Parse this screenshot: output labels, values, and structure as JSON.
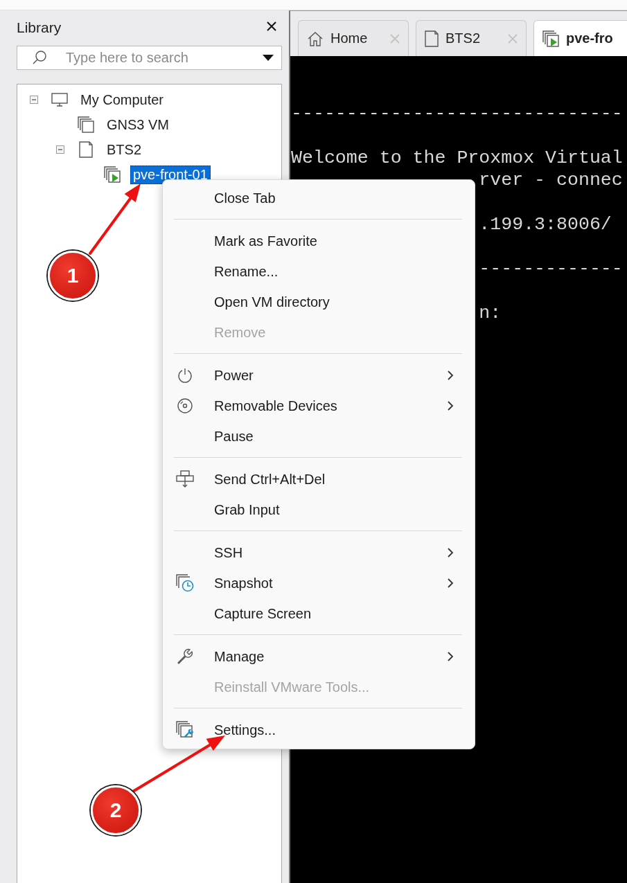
{
  "library": {
    "title": "Library"
  },
  "search": {
    "placeholder": "Type here to search"
  },
  "tree": [
    {
      "label": "My Computer",
      "kind": "computer",
      "expanded": true,
      "selected": false,
      "children": [
        {
          "label": "GNS3 VM",
          "kind": "vm",
          "running": false,
          "selected": false
        },
        {
          "label": "BTS2",
          "kind": "folder",
          "expanded": true,
          "selected": false,
          "children": [
            {
              "label": "pve-front-01",
              "kind": "vm",
              "running": true,
              "selected": true
            }
          ]
        }
      ]
    }
  ],
  "tabs": [
    {
      "label": "Home",
      "kind": "home",
      "selected": false
    },
    {
      "label": "BTS2",
      "kind": "folder",
      "selected": false
    },
    {
      "label": "pve-fro",
      "kind": "vm",
      "selected": true
    }
  ],
  "terminal": {
    "lines": [
      {
        "text": "------------------------------",
        "blank_before": false,
        "covered": false
      },
      {
        "text": "Welcome to the Proxmox Virtual",
        "blank_before": true,
        "covered": false
      },
      {
        "text": "rver - connec",
        "blank_before": false,
        "covered": true
      },
      {
        "text": ".199.3:8006/",
        "blank_before": true,
        "covered": true
      },
      {
        "text": "-------------",
        "blank_before": true,
        "covered": true
      },
      {
        "text": "n:",
        "blank_before": true,
        "covered": true
      }
    ]
  },
  "context_menu": {
    "items": [
      {
        "kind": "item",
        "label": "Close Tab",
        "submenu": false,
        "disabled": false
      },
      {
        "kind": "separator"
      },
      {
        "kind": "item",
        "label": "Mark as Favorite",
        "submenu": false,
        "disabled": false
      },
      {
        "kind": "item",
        "label": "Rename...",
        "submenu": false,
        "disabled": false
      },
      {
        "kind": "item",
        "label": "Open VM directory",
        "submenu": false,
        "disabled": false
      },
      {
        "kind": "item",
        "label": "Remove",
        "submenu": false,
        "disabled": true
      },
      {
        "kind": "separator"
      },
      {
        "kind": "item",
        "label": "Power",
        "submenu": true,
        "disabled": false
      },
      {
        "kind": "item",
        "label": "Removable Devices",
        "submenu": true,
        "disabled": false
      },
      {
        "kind": "item",
        "label": "Pause",
        "submenu": false,
        "disabled": false
      },
      {
        "kind": "separator"
      },
      {
        "kind": "item",
        "label": "Send Ctrl+Alt+Del",
        "submenu": false,
        "disabled": false
      },
      {
        "kind": "item",
        "label": "Grab Input",
        "submenu": false,
        "disabled": false
      },
      {
        "kind": "separator"
      },
      {
        "kind": "item",
        "label": "SSH",
        "submenu": true,
        "disabled": false
      },
      {
        "kind": "item",
        "label": "Snapshot",
        "submenu": true,
        "disabled": false
      },
      {
        "kind": "item",
        "label": "Capture Screen",
        "submenu": false,
        "disabled": false
      },
      {
        "kind": "separator"
      },
      {
        "kind": "item",
        "label": "Manage",
        "submenu": true,
        "disabled": false
      },
      {
        "kind": "item",
        "label": "Reinstall VMware Tools...",
        "submenu": false,
        "disabled": true
      },
      {
        "kind": "separator"
      },
      {
        "kind": "item",
        "label": "Settings...",
        "submenu": false,
        "disabled": false
      }
    ]
  },
  "annotations": [
    {
      "label": "1"
    },
    {
      "label": "2"
    }
  ]
}
